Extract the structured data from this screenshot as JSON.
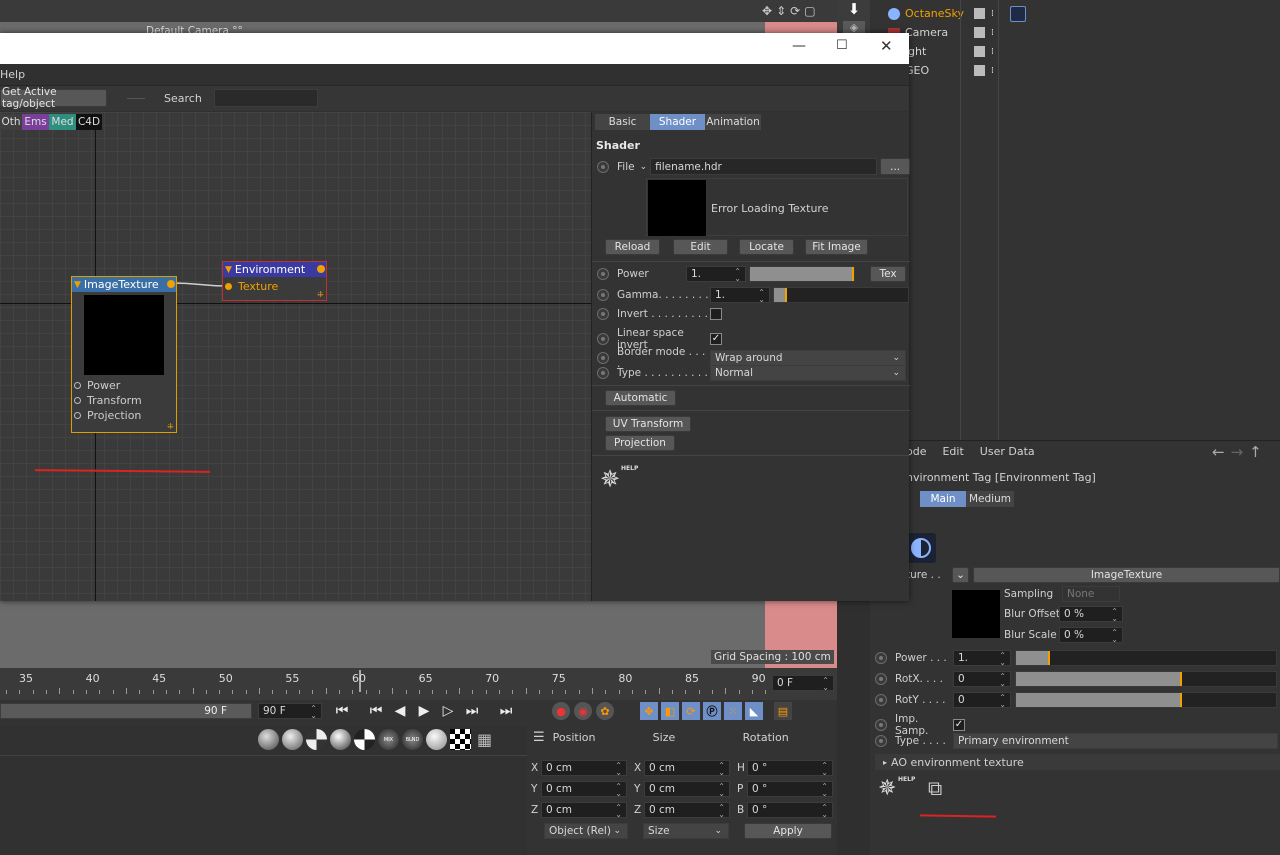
{
  "viewport": {
    "camera_label": "Default Camera °°",
    "grid_spacing": "Grid Spacing : 100 cm"
  },
  "object_manager": {
    "items": [
      {
        "name": "OctaneSky"
      },
      {
        "name": "Camera"
      },
      {
        "name": "ight"
      },
      {
        "name": "GEO"
      }
    ]
  },
  "node_editor": {
    "menu": "Help",
    "toolbar": {
      "get_active": "Get Active tag/object",
      "search_label": "Search",
      "search_value": ""
    },
    "filters": [
      "Oth",
      "Ems",
      "Med",
      "C4D"
    ],
    "filter_colors": [
      "#3f3f3f",
      "#7a3f9a",
      "#2f8f7f",
      "#111111"
    ],
    "nodes": {
      "image_texture": {
        "title": "ImageTexture",
        "ports": [
          "Power",
          "Transform",
          "Projection"
        ]
      },
      "environment": {
        "title": "Environment",
        "port": "Texture"
      }
    }
  },
  "shader_panel": {
    "tabs": [
      "Basic",
      "Shader",
      "Animation"
    ],
    "active_tab": "Shader",
    "section": "Shader",
    "file_label": "File",
    "file_value": "filename.hdr",
    "browse": "...",
    "error_text": "Error Loading Texture",
    "buttons": [
      "Reload",
      "Edit",
      "Locate",
      "Fit Image"
    ],
    "power": {
      "label": "Power",
      "value": "1.",
      "fraction": 1.0,
      "tex": "Tex"
    },
    "gamma": {
      "label": "Gamma. . . . . . . .",
      "value": "1.",
      "fraction": 0.1
    },
    "invert": {
      "label": "Invert . . . . . . . . .",
      "checked": false
    },
    "linear_invert": {
      "label": "Linear space invert",
      "checked": true
    },
    "border_mode": {
      "label": "Border mode . . . .",
      "value": "Wrap around"
    },
    "type": {
      "label": "Type . . . . . . . . . .",
      "value": "Normal"
    },
    "automatic": "Automatic",
    "uv_transform": "UV Transform",
    "projection": "Projection",
    "help": "HELP"
  },
  "timeline": {
    "ticks": [
      "35",
      "40",
      "45",
      "50",
      "55",
      "60",
      "65",
      "70",
      "75",
      "80",
      "85",
      "90"
    ],
    "current_frame": "0 F",
    "end_frame": "90 F",
    "end_frame_field": "90 F"
  },
  "coords": {
    "headers": [
      "Position",
      "Size",
      "Rotation"
    ],
    "rows": [
      {
        "p": "X",
        "pv": "0 cm",
        "s": "X",
        "sv": "0 cm",
        "r": "H",
        "rv": "0 °"
      },
      {
        "p": "Y",
        "pv": "0 cm",
        "s": "Y",
        "sv": "0 cm",
        "r": "P",
        "rv": "0 °"
      },
      {
        "p": "Z",
        "pv": "0 cm",
        "s": "Z",
        "sv": "0 cm",
        "r": "B",
        "rv": "0 °"
      }
    ],
    "mode": "Object (Rel)",
    "size_mode": "Size",
    "apply": "Apply"
  },
  "attributes": {
    "menu": [
      "ode",
      "Edit",
      "User Data"
    ],
    "title": "nvironment Tag [Environment Tag]",
    "tabs": [
      "Main",
      "Medium"
    ],
    "texture_label": "ture . .",
    "texture_value": "ImageTexture",
    "sampling": {
      "label": "Sampling",
      "value": "None"
    },
    "blur_offset": {
      "label": "Blur Offset",
      "value": "0 %"
    },
    "blur_scale": {
      "label": "Blur Scale",
      "value": "0 %"
    },
    "power": {
      "label": "Power . . .",
      "value": "1.",
      "fraction": 0.13
    },
    "rotx": {
      "label": "RotX. . . .",
      "value": "0",
      "fraction": 0.64
    },
    "roty": {
      "label": "RotY . . . .",
      "value": "0",
      "fraction": 0.64
    },
    "imp_samp": {
      "label": "Imp. Samp.",
      "checked": true
    },
    "type": {
      "label": "Type . . . .",
      "value": "Primary environment"
    },
    "ao": "AO environment texture",
    "help": "HELP"
  }
}
